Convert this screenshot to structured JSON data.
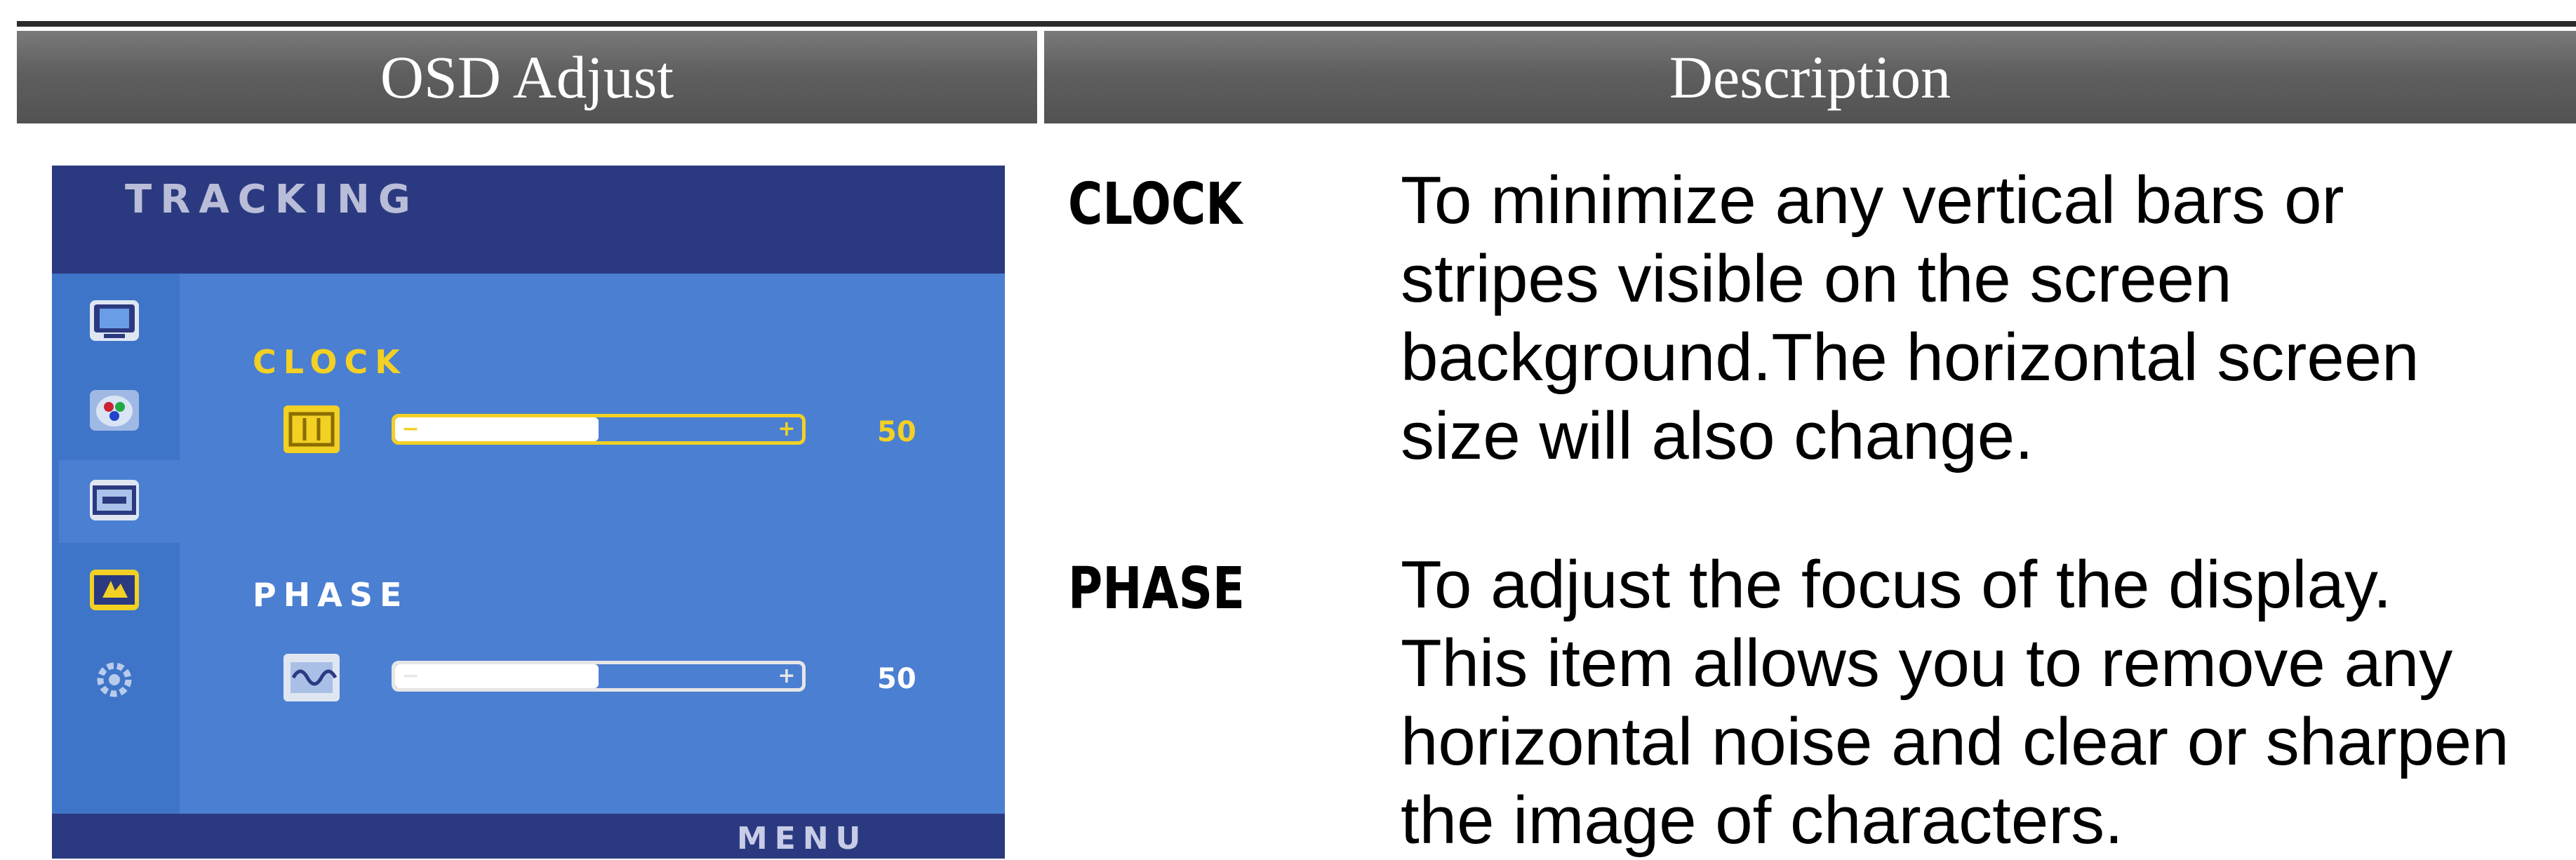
{
  "header": {
    "col1": "OSD Adjust",
    "col2": "Description"
  },
  "osd": {
    "title": "TRACKING",
    "sidebar_icons": [
      "picture-icon",
      "color-icon",
      "tracking-icon",
      "setup-icon",
      "options-icon"
    ],
    "clock": {
      "label": "CLOCK",
      "value": "50",
      "level_percent": 50
    },
    "phase": {
      "label": "PHASE",
      "value": "50",
      "level_percent": 50
    },
    "menu_label": "MENU",
    "colors": {
      "frame": "#2b3a80",
      "panel": "#4a7fd2",
      "sidebar": "#3e75c8",
      "selected_label": "#f2d024",
      "unselected_label": "#ffffff"
    }
  },
  "descriptions": [
    {
      "term": "CLOCK",
      "lines": [
        "To minimize any vertical bars or",
        "stripes visible on the screen",
        "background.The horizontal screen",
        "size will also change."
      ]
    },
    {
      "term": "PHASE",
      "lines": [
        "To adjust the focus of the display.",
        "This item allows you to remove any",
        "horizontal noise and clear or sharpen",
        "the image of characters."
      ]
    }
  ]
}
